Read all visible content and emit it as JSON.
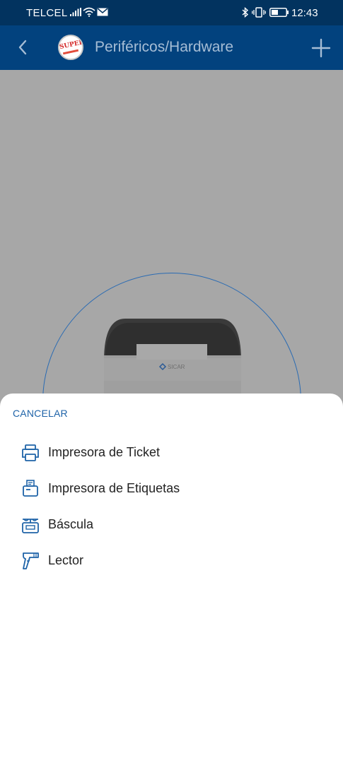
{
  "status_bar": {
    "carrier": "TELCEL",
    "time": "12:43",
    "icons": [
      "signal-icon",
      "wifi-icon",
      "mail-icon",
      "bluetooth-icon",
      "vibrate-icon",
      "battery-icon"
    ]
  },
  "app_bar": {
    "title": "Periféricos/Hardware",
    "logo_text": "SUPER",
    "back_icon": "chevron-left-icon",
    "add_icon": "plus-icon"
  },
  "illustration": {
    "brand": "SICAR"
  },
  "sheet": {
    "cancel_label": "CANCELAR",
    "items": [
      {
        "label": "Impresora de Ticket",
        "icon": "printer-icon"
      },
      {
        "label": "Impresora de Etiquetas",
        "icon": "label-printer-icon"
      },
      {
        "label": "Báscula",
        "icon": "scale-icon"
      },
      {
        "label": "Lector",
        "icon": "scanner-icon"
      }
    ]
  },
  "colors": {
    "status_bar": "#02335f",
    "app_bar": "#02427e",
    "accent": "#1e63a8",
    "scrim": "#a7a7a7"
  }
}
